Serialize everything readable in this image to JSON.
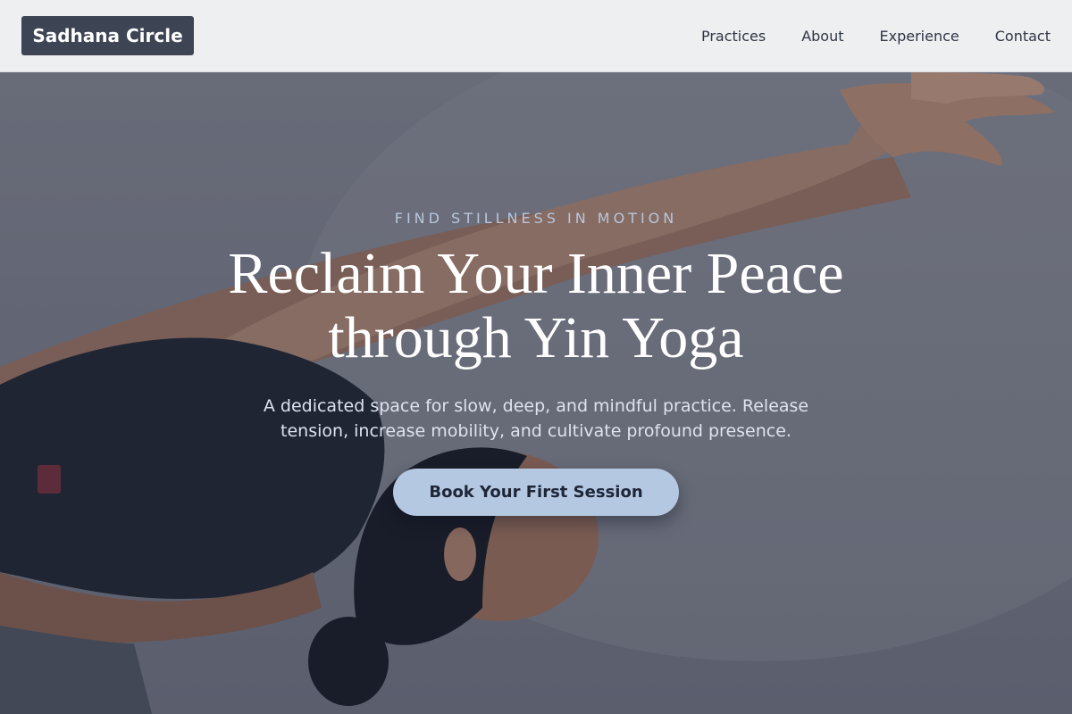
{
  "header": {
    "brand": "Sadhana Circle",
    "nav": [
      {
        "label": "Practices"
      },
      {
        "label": "About"
      },
      {
        "label": "Experience"
      },
      {
        "label": "Contact"
      }
    ]
  },
  "hero": {
    "eyebrow": "FIND STILLNESS IN MOTION",
    "headline_line1": "Reclaim Your Inner Peace",
    "headline_line2": "through Yin Yoga",
    "subtext": "A dedicated space for slow, deep, and mindful practice. Release tension, increase mobility, and cultivate profound presence.",
    "cta_label": "Book Your First Session",
    "image_subject": "woman-in-yoga-pose"
  },
  "colors": {
    "header_bg": "#eeeff1",
    "brand_bg": "#3d4554",
    "cta_bg": "#b4c8e2",
    "cta_text": "#1e2638",
    "eyebrow": "#b9c6dc"
  }
}
